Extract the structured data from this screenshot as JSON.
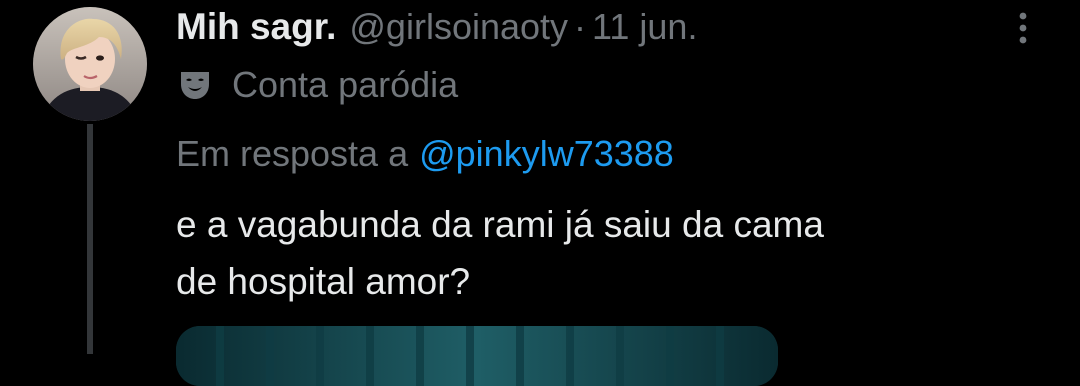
{
  "tweet": {
    "author": {
      "display_name": "Mih sagr.",
      "handle": "@girlsoinaoty",
      "date": "11 jun.",
      "separator": "·",
      "avatar_icon": "avatar-photo"
    },
    "label": {
      "icon": "theater-mask-icon",
      "text": "Conta paródia"
    },
    "reply": {
      "prefix": "Em resposta a",
      "mention": "@pinkylw73388"
    },
    "text_lines": [
      "e a vagabunda da rami já saiu da cama",
      "de hospital amor?"
    ],
    "more_icon": "more-vertical-icon"
  },
  "colors": {
    "background": "#000000",
    "primary_text": "#e7e9ea",
    "secondary_text": "#71767b",
    "link": "#1d9bf0",
    "thread_line": "#333639"
  }
}
